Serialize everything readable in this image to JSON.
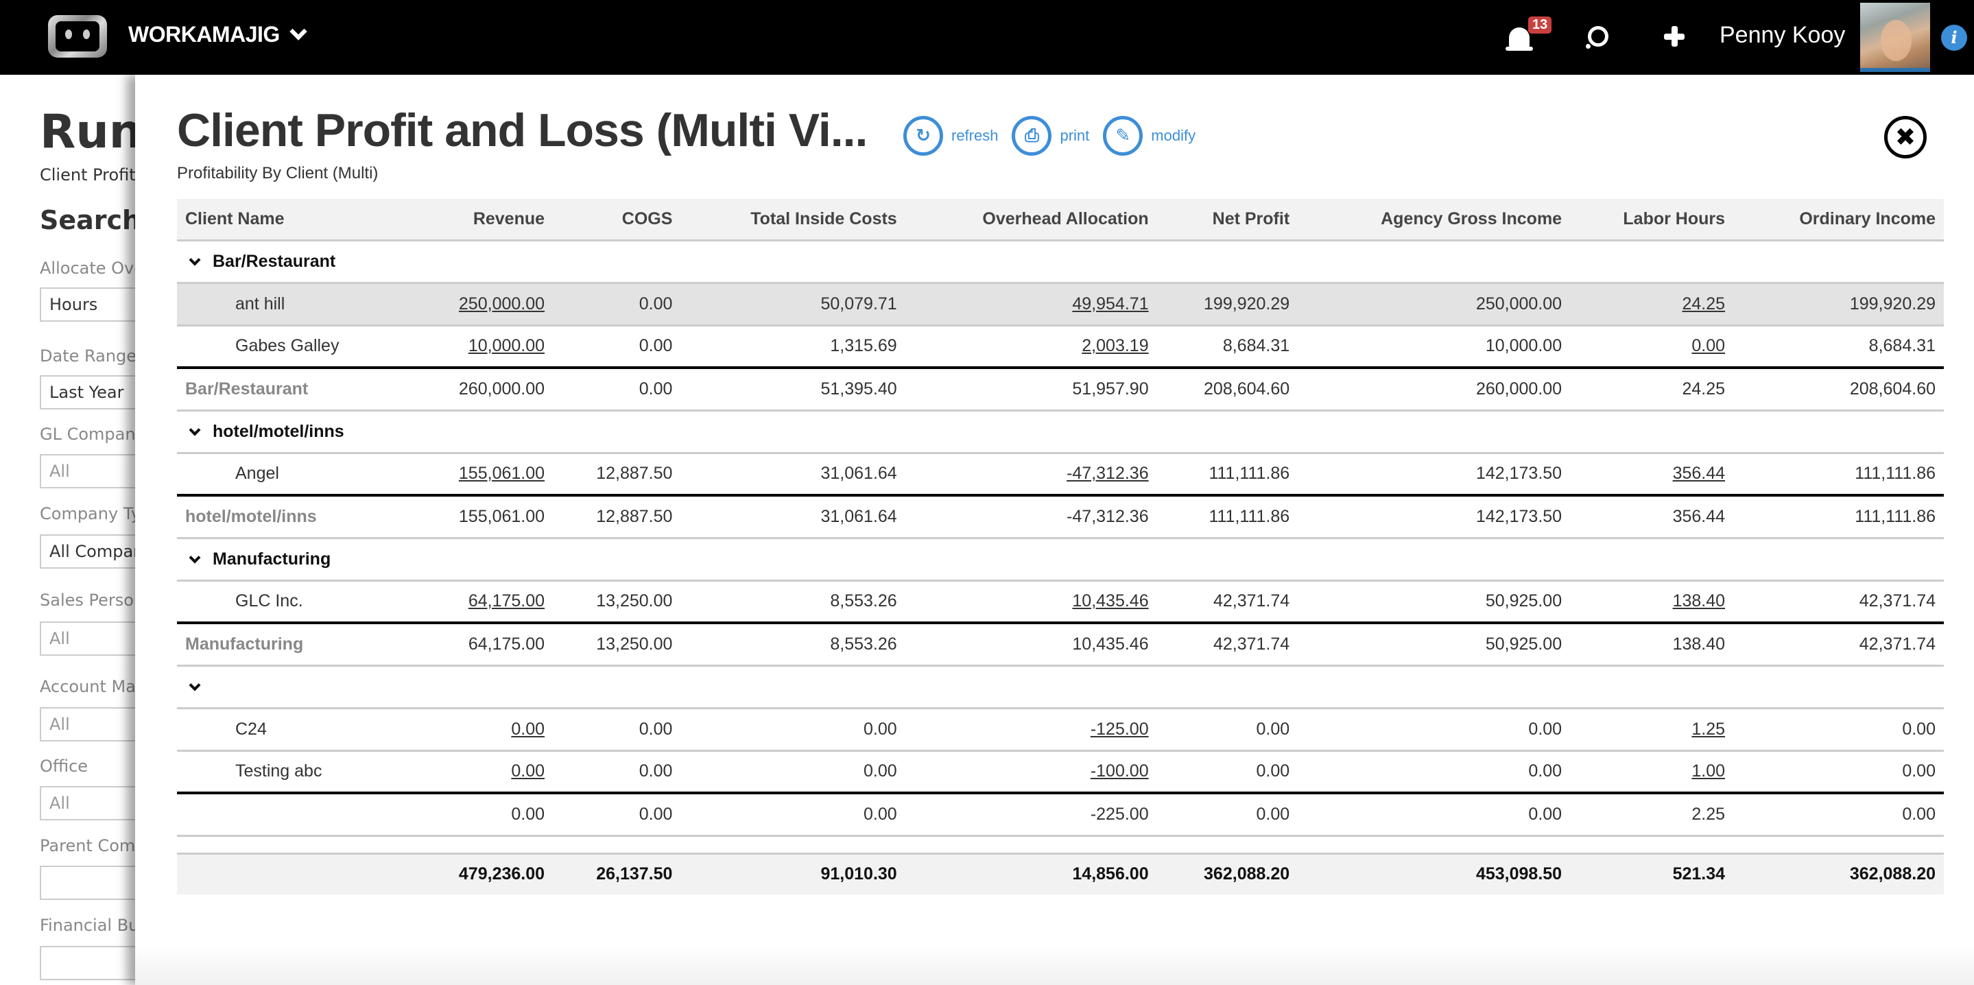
{
  "topbar": {
    "brand": "WORKAMAJIG",
    "notification_count": "13",
    "user_name": "Penny Kooy",
    "icons": [
      "workamajig-logo-icon",
      "bell-icon",
      "search-icon",
      "plus-icon",
      "info-icon"
    ]
  },
  "background_page": {
    "title": "Run",
    "subtitle": "Client Profit ...",
    "search_heading": "Search C...",
    "filters": [
      {
        "label": "Allocate Overhead",
        "value": "Hours"
      },
      {
        "label": "Date Range",
        "value": "Last Year"
      },
      {
        "label": "GL Company",
        "value": "All"
      },
      {
        "label": "Company Type",
        "value": "All Companies"
      },
      {
        "label": "Sales Person",
        "value": "All"
      },
      {
        "label": "Account Manager",
        "value": "All"
      },
      {
        "label": "Office",
        "value": "All"
      },
      {
        "label": "Parent Company",
        "value": ""
      },
      {
        "label": "Financial Budget",
        "value": ""
      }
    ]
  },
  "modal": {
    "title": "Client Profit and Loss (Multi Vi...",
    "subtitle": "Profitability By Client (Multi)",
    "actions": {
      "refresh": "refresh",
      "print": "print",
      "modify": "modify"
    },
    "close_icon": "close-circle-icon"
  },
  "table": {
    "columns": [
      "Client Name",
      "Revenue",
      "COGS",
      "Total Inside Costs",
      "Overhead Allocation",
      "Net Profit",
      "Agency Gross Income",
      "Labor Hours",
      "Ordinary Income"
    ],
    "groups": [
      {
        "name": "Bar/Restaurant",
        "clients": [
          {
            "name": "ant hill",
            "values": [
              "250,000.00",
              "0.00",
              "50,079.71",
              "49,954.71",
              "199,920.29",
              "250,000.00",
              "24.25",
              "199,920.29"
            ]
          },
          {
            "name": "Gabes Galley",
            "values": [
              "10,000.00",
              "0.00",
              "1,315.69",
              "2,003.19",
              "8,684.31",
              "10,000.00",
              "0.00",
              "8,684.31"
            ]
          }
        ],
        "subtotal": {
          "name": "Bar/Restaurant",
          "values": [
            "260,000.00",
            "0.00",
            "51,395.40",
            "51,957.90",
            "208,604.60",
            "260,000.00",
            "24.25",
            "208,604.60"
          ]
        }
      },
      {
        "name": "hotel/motel/inns",
        "clients": [
          {
            "name": "Angel",
            "values": [
              "155,061.00",
              "12,887.50",
              "31,061.64",
              "-47,312.36",
              "111,111.86",
              "142,173.50",
              "356.44",
              "111,111.86"
            ]
          }
        ],
        "subtotal": {
          "name": "hotel/motel/inns",
          "values": [
            "155,061.00",
            "12,887.50",
            "31,061.64",
            "-47,312.36",
            "111,111.86",
            "142,173.50",
            "356.44",
            "111,111.86"
          ]
        }
      },
      {
        "name": "Manufacturing",
        "clients": [
          {
            "name": "GLC Inc.",
            "values": [
              "64,175.00",
              "13,250.00",
              "8,553.26",
              "10,435.46",
              "42,371.74",
              "50,925.00",
              "138.40",
              "42,371.74"
            ]
          }
        ],
        "subtotal": {
          "name": "Manufacturing",
          "values": [
            "64,175.00",
            "13,250.00",
            "8,553.26",
            "10,435.46",
            "42,371.74",
            "50,925.00",
            "138.40",
            "42,371.74"
          ]
        }
      },
      {
        "name": "",
        "clients": [
          {
            "name": "C24",
            "values": [
              "0.00",
              "0.00",
              "0.00",
              "-125.00",
              "0.00",
              "0.00",
              "1.25",
              "0.00"
            ]
          },
          {
            "name": "Testing abc",
            "values": [
              "0.00",
              "0.00",
              "0.00",
              "-100.00",
              "0.00",
              "0.00",
              "1.00",
              "0.00"
            ]
          }
        ],
        "subtotal": {
          "name": "",
          "values": [
            "0.00",
            "0.00",
            "0.00",
            "-225.00",
            "0.00",
            "0.00",
            "2.25",
            "0.00"
          ]
        }
      }
    ],
    "linked_columns": [
      0,
      3,
      6
    ],
    "highlighted_client": "ant hill",
    "grand_total": [
      "479,236.00",
      "26,137.50",
      "91,010.30",
      "14,856.00",
      "362,088.20",
      "453,098.50",
      "521.34",
      "362,088.20"
    ]
  },
  "colors": {
    "topbar_bg": "#000000",
    "accent_blue": "#3d8ed8",
    "badge_red": "#c9403f",
    "header_bg": "#f2f2f2",
    "highlight_row": "#e3e3e3"
  }
}
